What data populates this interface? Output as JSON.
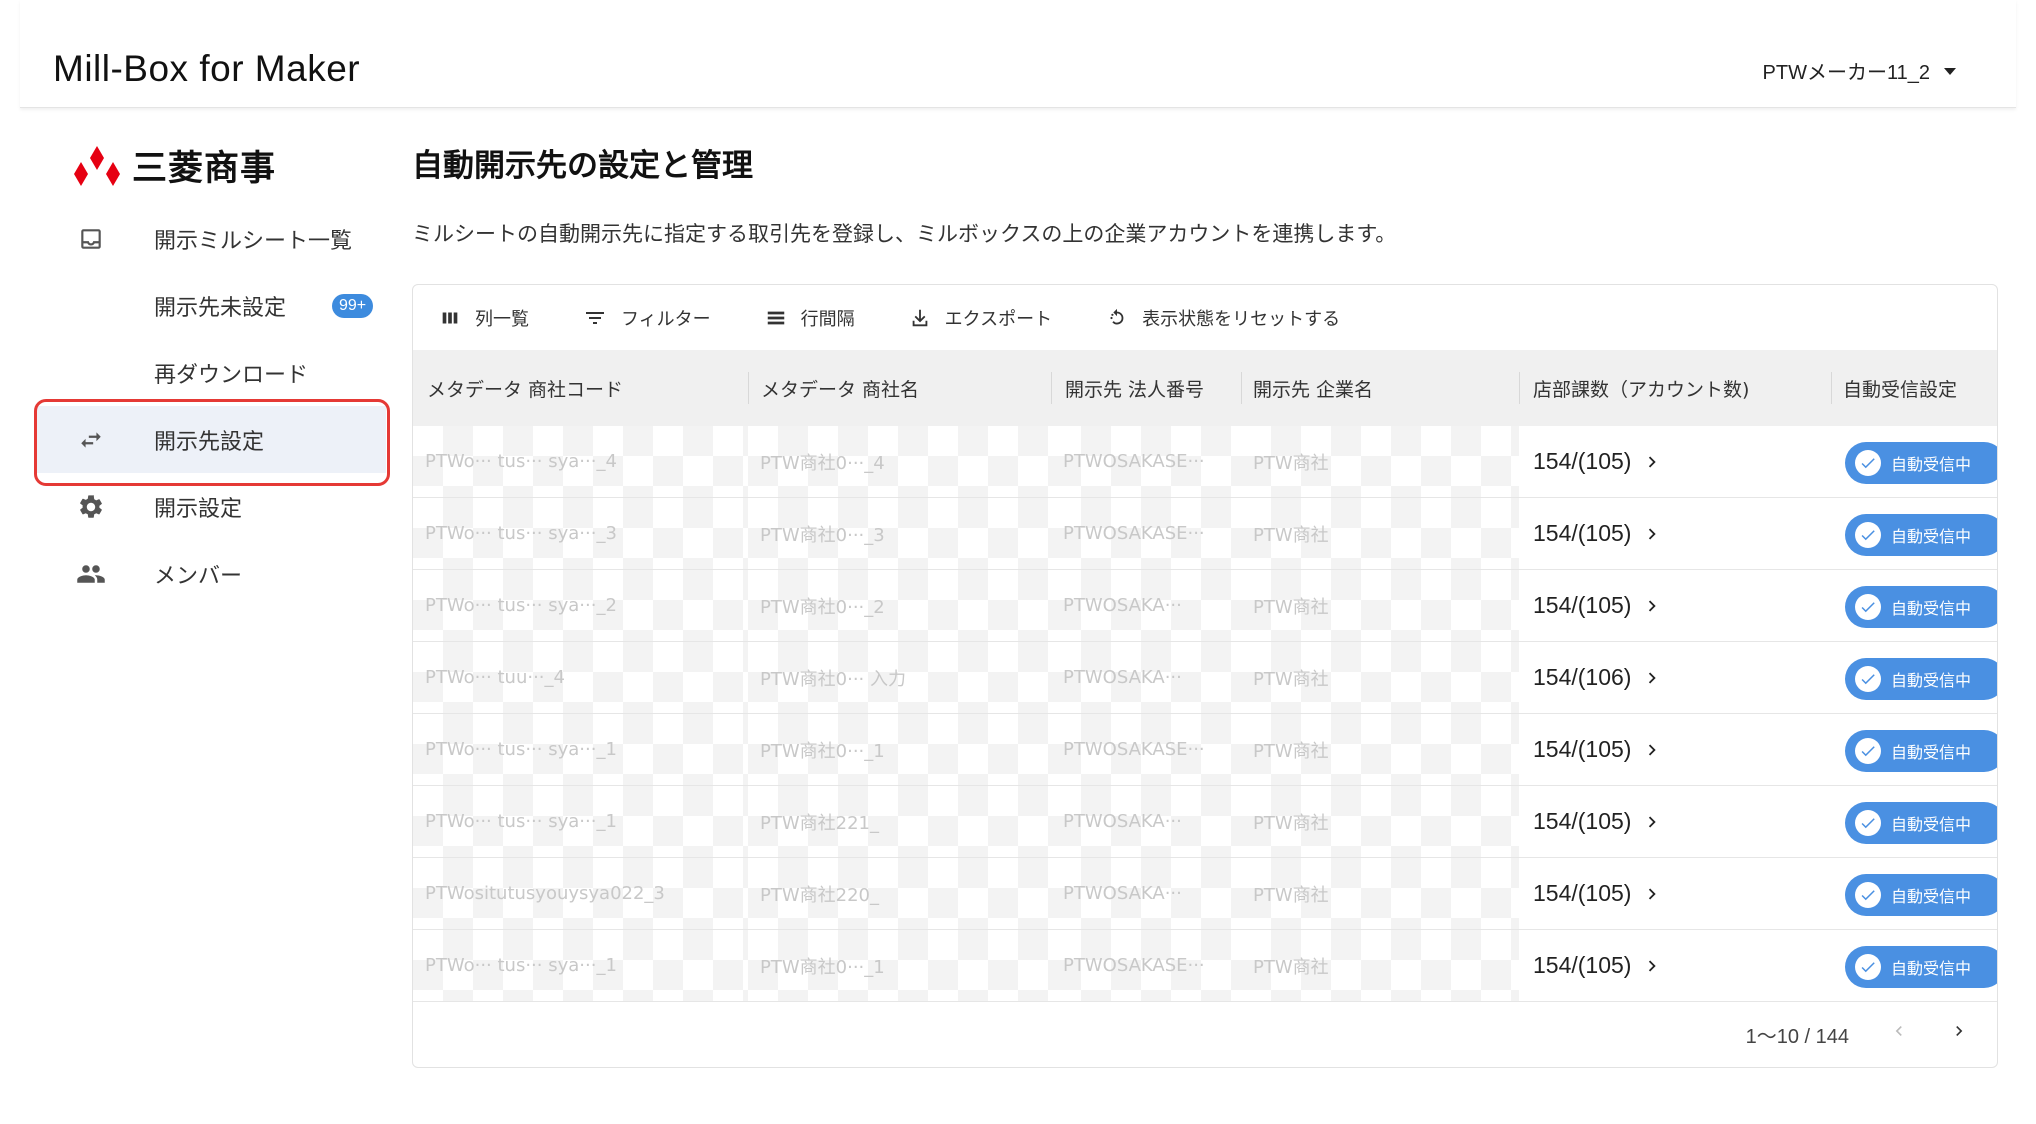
{
  "header": {
    "app_title": "Mill-Box for Maker",
    "account_name": "PTWメーカー11_2"
  },
  "sidebar": {
    "logo_text": "三菱商事",
    "items": [
      {
        "label": "開示ミルシート一覧",
        "icon": "inbox-icon"
      },
      {
        "label": "開示先未設定",
        "icon": "",
        "badge": "99+"
      },
      {
        "label": "再ダウンロード",
        "icon": ""
      },
      {
        "label": "開示先設定",
        "icon": "swap-arrows-icon",
        "active": true
      },
      {
        "label": "開示設定",
        "icon": "gear-icon"
      },
      {
        "label": "メンバー",
        "icon": "people-icon"
      }
    ]
  },
  "main": {
    "title": "自動開示先の設定と管理",
    "description": "ミルシートの自動開示先に指定する取引先を登録し、ミルボックスの上の企業アカウントを連携します。"
  },
  "toolbar": {
    "columns_label": "列一覧",
    "filter_label": "フィルター",
    "density_label": "行間隔",
    "export_label": "エクスポート",
    "reset_label": "表示状態をリセットする"
  },
  "table": {
    "headers": [
      "メタデータ 商社コード",
      "メタデータ 商社名",
      "開示先 法人番号",
      "開示先 企業名",
      "店部課数（アカウント数)",
      "自動受信設定"
    ],
    "rows": [
      {
        "code": "PTWo··· tus··· sya···_4",
        "name": "PTW商社0···_4",
        "corp_no": "PTWOSAKASE···",
        "company": "PTW商社",
        "count": "154/(105)",
        "status": "自動受信中"
      },
      {
        "code": "PTWo··· tus··· sya···_3",
        "name": "PTW商社0···_3",
        "corp_no": "PTWOSAKASE···",
        "company": "PTW商社",
        "count": "154/(105)",
        "status": "自動受信中"
      },
      {
        "code": "PTWo··· tus··· sya···_2",
        "name": "PTW商社0···_2",
        "corp_no": "PTWOSAKA···",
        "company": "PTW商社",
        "count": "154/(105)",
        "status": "自動受信中"
      },
      {
        "code": "PTWo··· tuu···_4",
        "name": "PTW商社0··· 入力",
        "corp_no": "PTWOSAKA···",
        "company": "PTW商社",
        "count": "154/(106)",
        "status": "自動受信中"
      },
      {
        "code": "PTWo··· tus··· sya···_1",
        "name": "PTW商社0···_1",
        "corp_no": "PTWOSAKASE···",
        "company": "PTW商社",
        "count": "154/(105)",
        "status": "自動受信中"
      },
      {
        "code": "PTWo··· tus··· sya···_1",
        "name": "PTW商社221_",
        "corp_no": "PTWOSAKA···",
        "company": "PTW商社",
        "count": "154/(105)",
        "status": "自動受信中"
      },
      {
        "code": "PTWositutusyouysya022_3",
        "name": "PTW商社220_",
        "corp_no": "PTWOSAKA···",
        "company": "PTW商社",
        "count": "154/(105)",
        "status": "自動受信中"
      },
      {
        "code": "PTWo··· tus··· sya···_1",
        "name": "PTW商社0···_1",
        "corp_no": "PTWOSAKASE···",
        "company": "PTW商社",
        "count": "154/(105)",
        "status": "自動受信中"
      }
    ]
  },
  "pagination": {
    "range_text": "1〜10 / 144"
  },
  "colors": {
    "accent": "#4a90e2",
    "badge": "#3d8bde",
    "highlight_border": "#e53935",
    "brand_red": "#e60012"
  }
}
